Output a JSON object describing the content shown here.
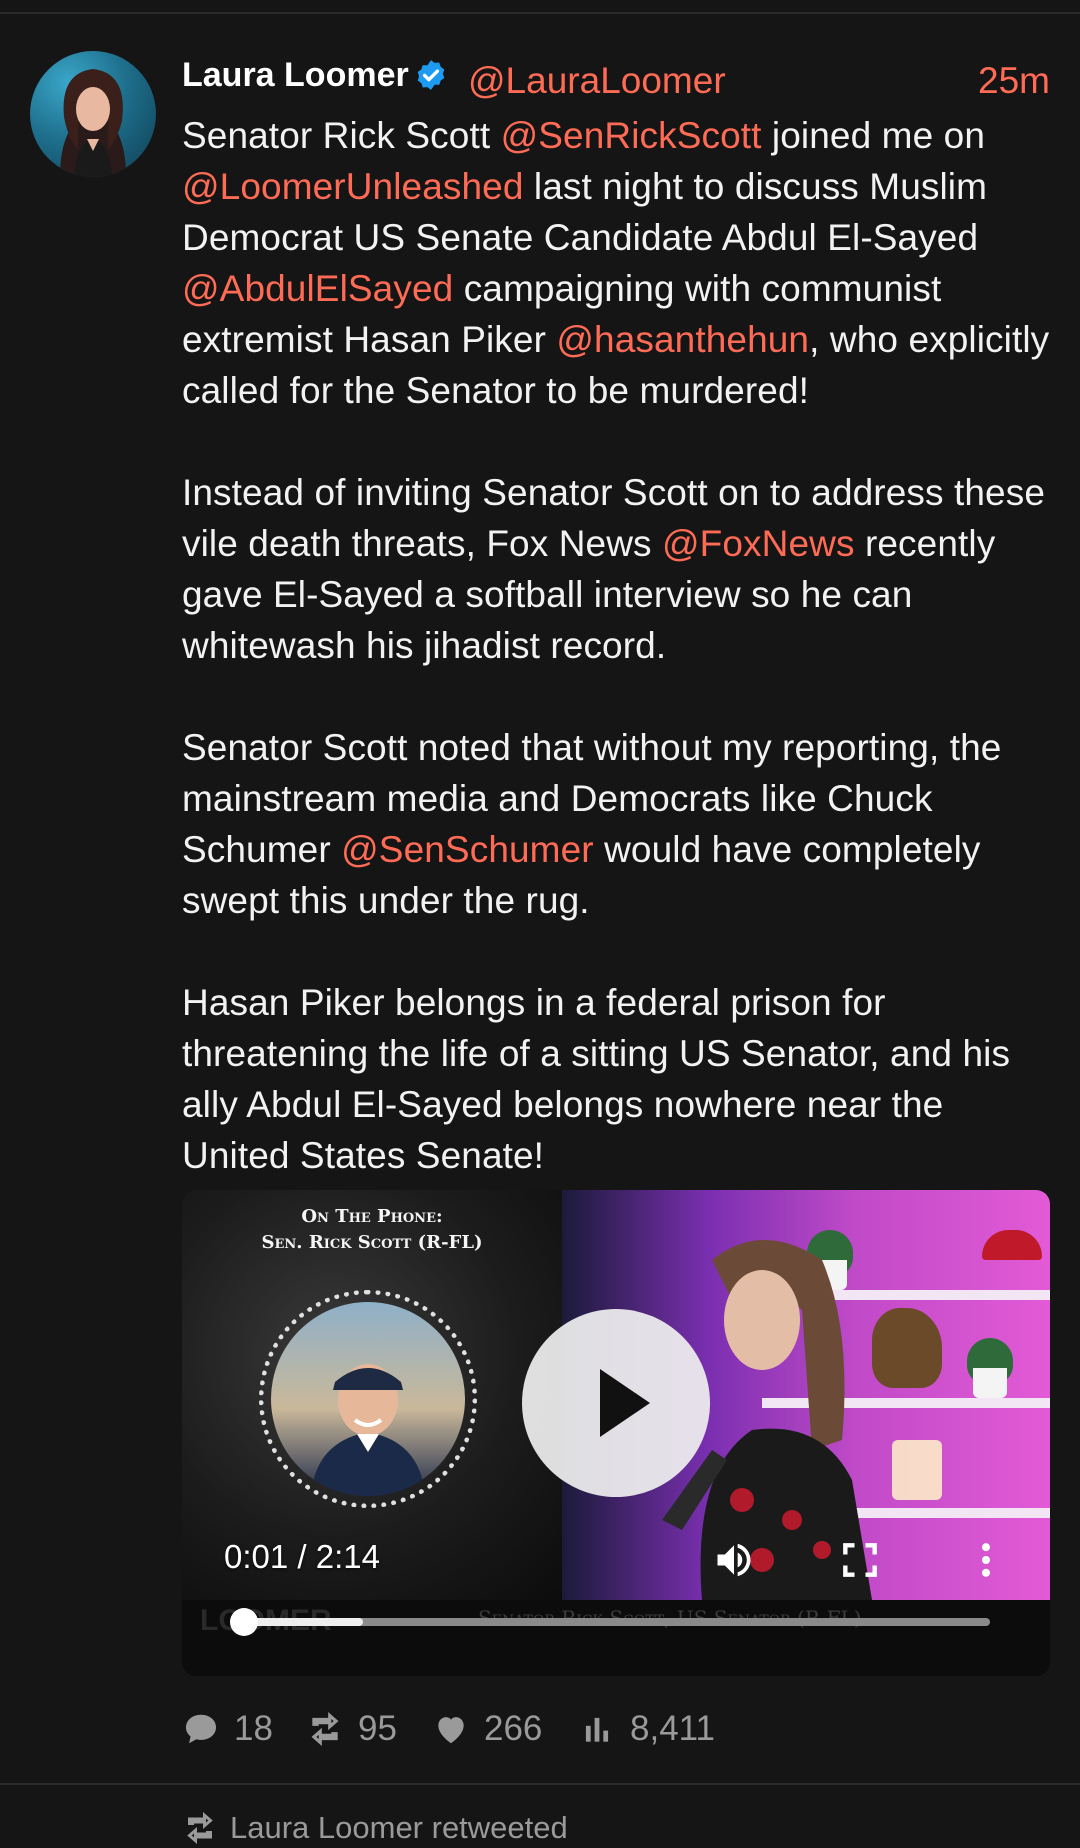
{
  "post": {
    "author_name": "Laura Loomer",
    "author_handle": "@LauraLoomer",
    "timestamp": "25m",
    "paragraphs": [
      [
        {
          "t": "Senator Rick Scott "
        },
        {
          "t": "@SenRickScott",
          "m": true
        },
        {
          "t": " joined me on "
        },
        {
          "t": "@LoomerUnleashed",
          "m": true
        },
        {
          "t": " last night to discuss Muslim Democrat US Senate Candidate Abdul El-Sayed "
        },
        {
          "t": "@AbdulElSayed",
          "m": true
        },
        {
          "t": " campaigning with communist extremist Hasan Piker "
        },
        {
          "t": "@hasanthehun",
          "m": true
        },
        {
          "t": ", who explicitly called for the Senator to be murdered!"
        }
      ],
      [
        {
          "t": "Instead of inviting Senator Scott on to address these vile death threats, Fox News "
        },
        {
          "t": "@FoxNews",
          "m": true
        },
        {
          "t": " recently gave El-Sayed a softball interview so he can whitewash his jihadist record."
        }
      ],
      [
        {
          "t": "Senator Scott noted that without my reporting, the mainstream media and Democrats like Chuck Schumer "
        },
        {
          "t": "@SenSchumer",
          "m": true
        },
        {
          "t": " would have completely swept this under the rug."
        }
      ],
      [
        {
          "t": "Hasan Piker belongs in a federal prison for threatening the life of a sitting US Senator, and his ally Abdul El-Sayed belongs nowhere near the United States Senate!"
        }
      ]
    ]
  },
  "video": {
    "overlay_title_line1": "On The Phone:",
    "overlay_title_line2": "Sen. Rick Scott (R-FL)",
    "time_display": "0:01 / 2:14",
    "played_fraction": 0.16,
    "lower_caption": "Senator Rick Scott, US Senator (R-FL)",
    "lower_logo": "LOOMER"
  },
  "stats": {
    "replies": "18",
    "reposts": "95",
    "likes": "266",
    "views": "8,411"
  },
  "next_item": {
    "label": "Laura Loomer retweeted"
  },
  "colors": {
    "background": "#151515",
    "accent": "#ff6b55",
    "text": "#f2f2f2",
    "muted": "#9a9a9a",
    "verified": "#1d9bf0"
  },
  "icons": {
    "verified": "verified-badge-icon",
    "play": "play-icon",
    "volume": "volume-icon",
    "fullscreen": "fullscreen-icon",
    "more": "more-vertical-icon",
    "reply": "reply-icon",
    "repost": "repost-icon",
    "like": "heart-icon",
    "views": "views-icon",
    "retweet": "retweet-icon"
  }
}
